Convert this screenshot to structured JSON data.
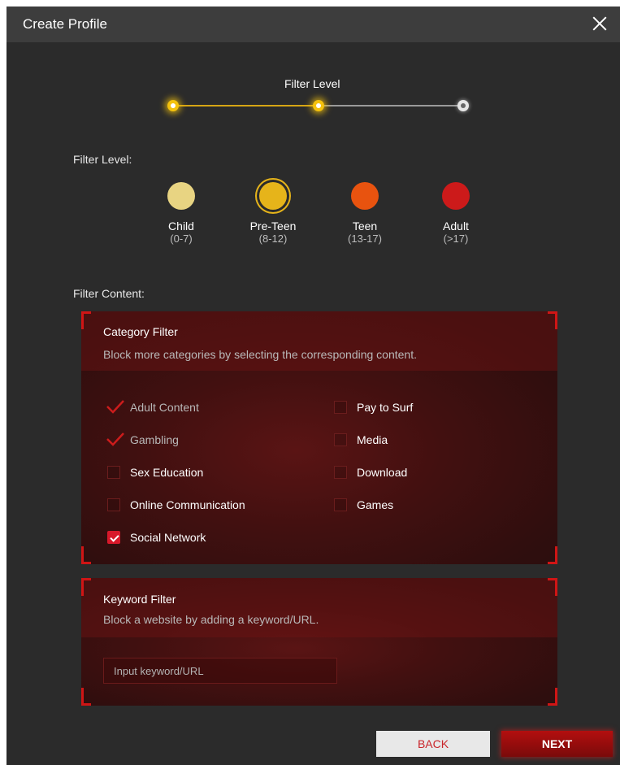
{
  "dialog": {
    "title": "Create Profile"
  },
  "stepper": {
    "label": "Filter Level",
    "steps_total": 3,
    "current_step": 2
  },
  "filter_level": {
    "label": "Filter Level:",
    "selected": "Pre-Teen",
    "levels": [
      {
        "name": "Child",
        "range": "(0-7)",
        "color": "#e8d482"
      },
      {
        "name": "Pre-Teen",
        "range": "(8-12)",
        "color": "#e6b41a"
      },
      {
        "name": "Teen",
        "range": "(13-17)",
        "color": "#e8530f"
      },
      {
        "name": "Adult",
        "range": "(>17)",
        "color": "#cc1a1a"
      }
    ]
  },
  "filter_content": {
    "label": "Filter Content:",
    "category": {
      "title": "Category Filter",
      "desc": "Block more categories by selecting the corresponding content.",
      "items": [
        {
          "label": "Adult Content",
          "state": "locked-checked"
        },
        {
          "label": "Pay to Surf",
          "state": "unchecked"
        },
        {
          "label": "Gambling",
          "state": "locked-checked"
        },
        {
          "label": "Media",
          "state": "unchecked"
        },
        {
          "label": "Sex Education",
          "state": "unchecked"
        },
        {
          "label": "Download",
          "state": "unchecked"
        },
        {
          "label": "Online Communication",
          "state": "unchecked"
        },
        {
          "label": "Games",
          "state": "unchecked"
        },
        {
          "label": "Social Network",
          "state": "checked"
        }
      ]
    },
    "keyword": {
      "title": "Keyword Filter",
      "desc": "Block a website by adding a keyword/URL.",
      "placeholder": "Input keyword/URL",
      "value": ""
    }
  },
  "buttons": {
    "back": "BACK",
    "next": "NEXT"
  },
  "colors": {
    "accent": "#d8182a",
    "active_step": "#f4c20d",
    "background": "#2b2b2b"
  }
}
